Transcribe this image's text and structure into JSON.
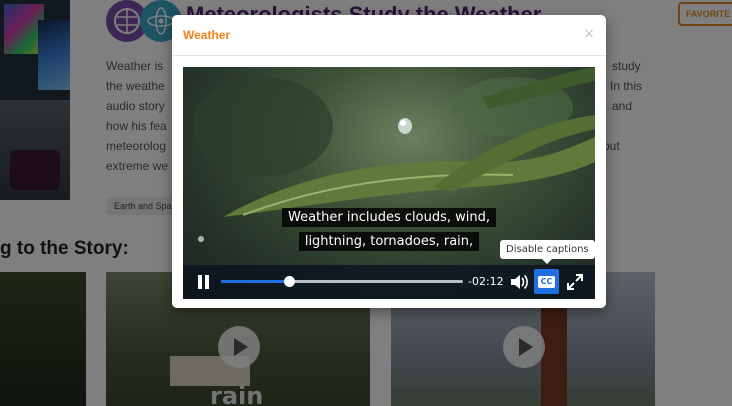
{
  "page": {
    "title": "Meteorologists Study the Weather",
    "favorite_label": "FAVORITE",
    "intro_lines": [
      "Weather is",
      "the weathe",
      "audio story",
      "how his fea",
      "meteorolog",
      "extreme we"
    ],
    "intro_right": [
      "study",
      "In this",
      "and",
      "out"
    ],
    "tag": "Earth and Spa",
    "section_heading": "g to the Story:",
    "card_b_word": "rain"
  },
  "modal": {
    "title": "Weather",
    "close_glyph": "×"
  },
  "player": {
    "captions": [
      "Weather includes clouds, wind,",
      "lightning, tornadoes, rain,"
    ],
    "time_remaining": "-02:12",
    "progress": 0.28,
    "cc_label": "CC",
    "tooltip": "Disable captions"
  },
  "colors": {
    "accent_orange": "#f07f1a",
    "player_blue": "#1e6fe0",
    "title_purple": "#53257a"
  },
  "icons": [
    "subject-earth-icon",
    "subject-atom-icon",
    "close-icon",
    "pause-icon",
    "volume-icon",
    "closed-captions-icon",
    "fullscreen-icon",
    "play-icon"
  ]
}
